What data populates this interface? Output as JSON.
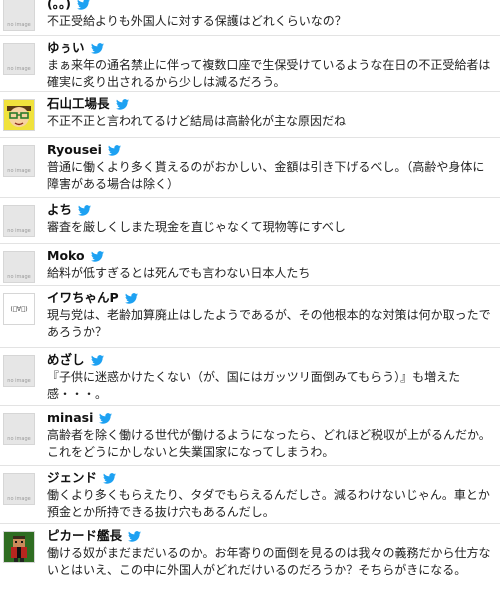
{
  "colors": {
    "divider": "#e3e3e3",
    "bird": "#1da1f2",
    "noimage_bg": "#e6e6e6"
  },
  "avatar_placeholder_label": "no image",
  "tweets": [
    {
      "name": "(。。)",
      "avatar": "noimage",
      "text": "不正受給よりも外国人に対する保護はどれくらいなの？"
    },
    {
      "name": "ゆぅい",
      "avatar": "noimage",
      "text": "まぁ来年の通名禁止に伴って複数口座で生保受けているような在日の不正受給者は確実に炙り出されるから少しは減るだろう。"
    },
    {
      "name": "石山工場長",
      "avatar": "glasses-face",
      "text": "不正不正と言われてるけど結局は高齢化が主な原因だね"
    },
    {
      "name": "Ryousei",
      "avatar": "noimage",
      "text": "普通に働くより多く貰えるのがおかしい、金額は引き下げるべし。（高齢や身体に障害がある場合は除く）"
    },
    {
      "name": "よち",
      "avatar": "noimage",
      "text": "審査を厳しくしまた現金を直じゃなくて現物等にすべし"
    },
    {
      "name": "Moko",
      "avatar": "noimage",
      "text": "給料が低すぎるとは死んでも言わない日本人たち"
    },
    {
      "name": "イワちゃんP",
      "avatar": "face-text",
      "avatar_text": "(ﾟ∀ﾟ)",
      "text": "現与党は、老齢加算廃止はしたようであるが、その他根本的な対策は何か取ったであろうか？"
    },
    {
      "name": "めざし",
      "avatar": "noimage",
      "text": "『子供に迷惑かけたくない（が、国にはガッツリ面倒みてもらう）』も増えた感・・・。"
    },
    {
      "name": "minasi",
      "avatar": "noimage",
      "text": "高齢者を除く働ける世代が働けるようになったら、どれほど税収が上がるんだか。これをどうにかしないと失業国家になってしまうわ。"
    },
    {
      "name": "ジェンド",
      "avatar": "noimage",
      "text": "働くより多くもらえたり、タダでもらえるんだしさ。減るわけないじゃん。車とか預金とか所持できる抜け穴もあるんだし。"
    },
    {
      "name": "ピカード艦長",
      "avatar": "pixel-character",
      "text": "働ける奴がまだまだいるのか。お年寄りの面倒を見るのは我々の義務だから仕方ないとはいえ、この中に外国人がどれだけいるのだろうか？そちらがきになる。"
    }
  ]
}
